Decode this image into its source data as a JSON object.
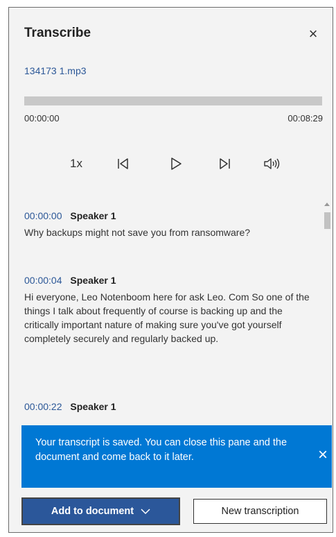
{
  "pane": {
    "title": "Transcribe",
    "close_icon": "×",
    "file_name": "134173 1.mp3"
  },
  "player": {
    "progress": 0,
    "time_start": "00:00:00",
    "time_end": "00:08:29",
    "speed": "1x",
    "controls": [
      "skip-back-icon",
      "play-icon",
      "skip-forward-icon",
      "volume-icon"
    ]
  },
  "transcript": {
    "entries": [
      {
        "timestamp": "00:00:00",
        "speaker": "Speaker 1",
        "text": "Why backups might not save you from ransomware?"
      },
      {
        "timestamp": "00:00:04",
        "speaker": "Speaker 1",
        "text": "Hi everyone, Leo Notenboom here for ask Leo. Com So one of the things I talk about frequently of course is backing up and the critically important nature of making sure you've got yourself completely securely and regularly backed up."
      },
      {
        "timestamp": "00:00:22",
        "speaker": "Speaker 1",
        "text": ""
      }
    ]
  },
  "toast": {
    "message": "Your transcript is saved. You can close this pane and the document and come back to it later.",
    "close_icon": "×",
    "color": "#0078d4"
  },
  "footer": {
    "add_label": "Add to document",
    "new_label": "New transcription",
    "accent": "#2b579a"
  }
}
